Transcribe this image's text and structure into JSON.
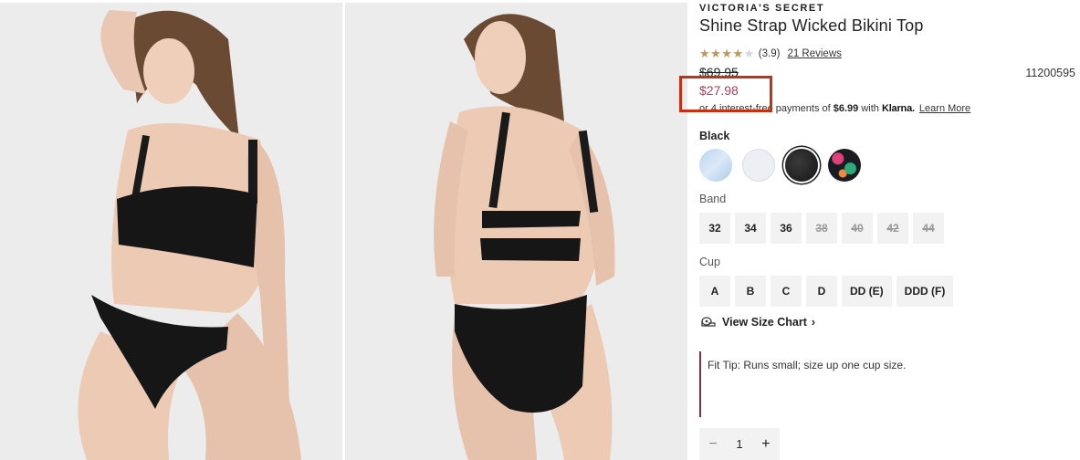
{
  "product": {
    "brand": "VICTORIA'S SECRET",
    "title": "Shine Strap Wicked Bikini Top",
    "rating": 3.9,
    "rating_text": "(3.9)",
    "reviews_label": "21 Reviews",
    "original_price": "$69.95",
    "sale_price": "$27.98",
    "sku": "11200595"
  },
  "klarna": {
    "prefix": "or 4 interest-free payments of ",
    "amount": "$6.99",
    "middle": " with ",
    "brand": "Klarna.",
    "learn_more": "Learn More"
  },
  "color": {
    "selected_label": "Black",
    "swatches": [
      {
        "name": "light-blue",
        "color": "#c9dff3"
      },
      {
        "name": "white",
        "color": "#eeeef5"
      },
      {
        "name": "black",
        "color": "#1c1c1c",
        "selected": true
      },
      {
        "name": "floral-print",
        "color": "#1b1b22"
      }
    ]
  },
  "band": {
    "label": "Band",
    "sizes": [
      {
        "label": "32",
        "available": true
      },
      {
        "label": "34",
        "available": true
      },
      {
        "label": "36",
        "available": true
      },
      {
        "label": "38",
        "available": false
      },
      {
        "label": "40",
        "available": false
      },
      {
        "label": "42",
        "available": false
      },
      {
        "label": "44",
        "available": false
      }
    ]
  },
  "cup": {
    "label": "Cup",
    "sizes": [
      {
        "label": "A"
      },
      {
        "label": "B"
      },
      {
        "label": "C"
      },
      {
        "label": "D"
      },
      {
        "label": "DD (E)"
      },
      {
        "label": "DDD (F)"
      }
    ]
  },
  "size_chart": {
    "label": "View Size Chart"
  },
  "fit_tip": "Fit Tip: Runs small; size up one cup size.",
  "quantity": {
    "value": "1",
    "minus": "−",
    "plus": "+"
  },
  "accent_colors": {
    "sale": "#b23a5e",
    "rating_star": "#bb9b5c",
    "highlight": "#c53211"
  }
}
